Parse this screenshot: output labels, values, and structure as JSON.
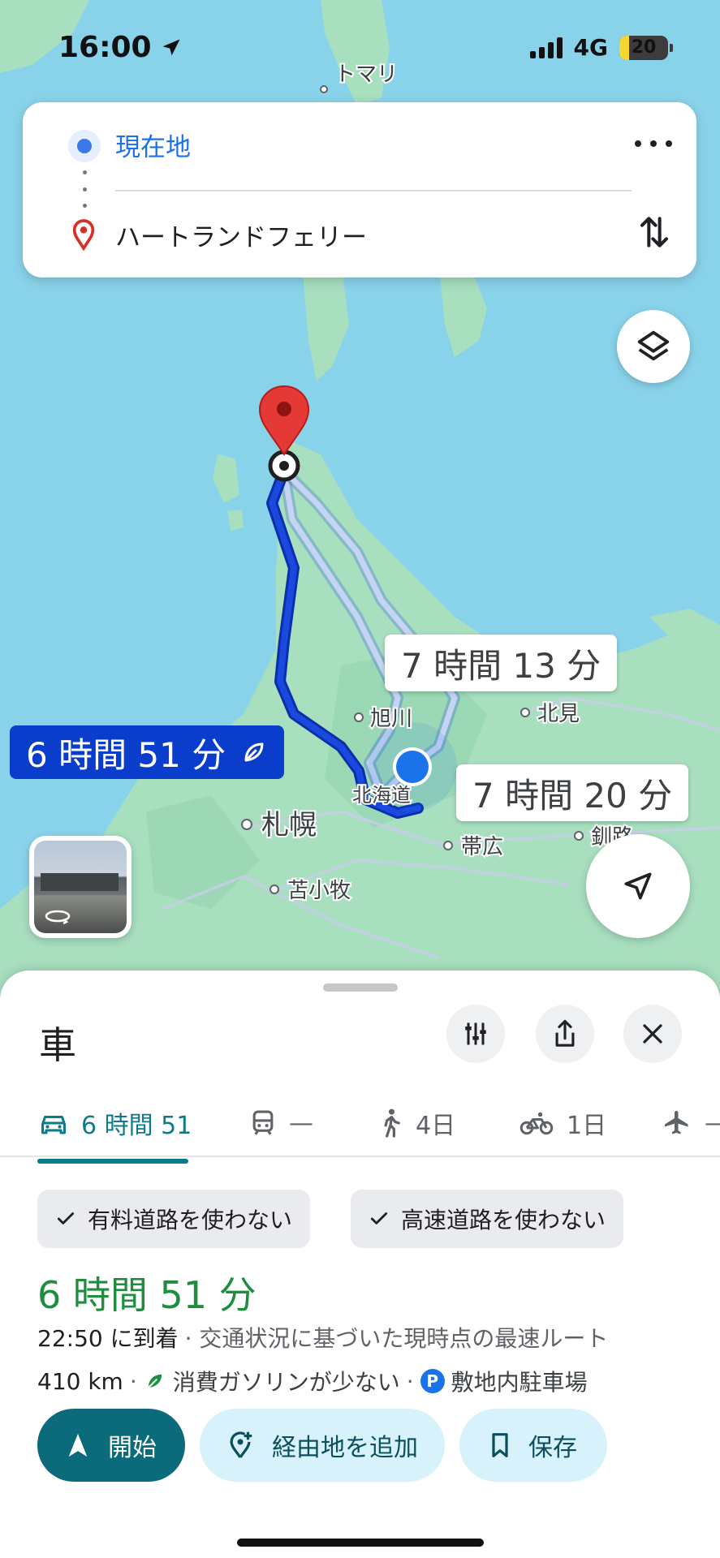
{
  "status_bar": {
    "time": "16:00",
    "network": "4G",
    "battery": "20",
    "battery_level": 0.2
  },
  "route_card": {
    "origin": "現在地",
    "destination": "ハートランドフェリー"
  },
  "map": {
    "place_labels": {
      "tomari": "トマリ",
      "asahikawa": "旭川",
      "kitami": "北見",
      "hokkaido": "北海道",
      "sapporo": "札幌",
      "obihiro": "帯広",
      "kushiro": "釧路",
      "tomakomai": "苫小牧"
    },
    "route_times": {
      "primary": "6 時間 51 分",
      "alt1": "7 時間 13 分",
      "alt2": "7 時間 20 分"
    },
    "colors": {
      "water": "#89d3ea",
      "land": "#a8dfbf",
      "primary_route": "#1a49e0",
      "alt_route": "#c7d3f2"
    }
  },
  "sheet": {
    "title": "車",
    "tabs": {
      "drive": "6 時間 51",
      "transit": "—",
      "walk": "4日",
      "bike": "1日",
      "flight": "—"
    },
    "chips": {
      "no_tolls": "有料道路を使わない",
      "no_highways": "高速道路を使わない"
    },
    "duration": "6 時間 51 分",
    "arrival_time": "22:50 に到着",
    "arrival_note": "· 交通状況に基づいた現時点の最速ルート",
    "distance": "410 km",
    "sep1": "·",
    "eco_note": "消費ガソリンが少ない",
    "sep2": "·",
    "parking_badge": "P",
    "parking_note": "敷地内駐車場",
    "actions": {
      "start": "開始",
      "add_stop": "経由地を追加",
      "save": "保存"
    }
  }
}
